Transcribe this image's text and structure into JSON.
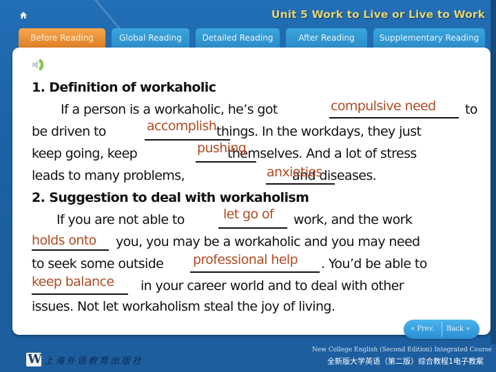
{
  "header": {
    "home_icon": "home-icon",
    "unit_title": "Unit 5  Work to Live or Live to Work"
  },
  "tabs": [
    {
      "label": "Before Reading",
      "active": true
    },
    {
      "label": "Global Reading",
      "active": false
    },
    {
      "label": "Detailed Reading",
      "active": false
    },
    {
      "label": "After Reading",
      "active": false
    },
    {
      "label": "Supplementary Reading",
      "active": false
    }
  ],
  "content": {
    "speaker_icon": "speaker-icon",
    "section1": {
      "heading": "1. Definition of workaholic",
      "l1_a": "If a person is a workaholic, he’s got",
      "l1_answer": "compulsive need",
      "l1_b": "to",
      "l2_a": "be driven to",
      "l2_answer": "accomplish",
      "l2_b": "things. In the workdays, they just",
      "l3_a": "keep going, keep",
      "l3_answer": "pushing",
      "l3_b": "themselves. And a lot of stress",
      "l4_a": "leads to many problems,",
      "l4_answer": "anxieties",
      "l4_b": "and diseases."
    },
    "section2": {
      "heading": "2. Suggestion to deal with workaholism",
      "l1_a": "If you are not able to",
      "l1_answer": "let go of",
      "l1_b": "work, and the work",
      "l2_answer": "holds onto",
      "l2_b": "you, you may be a workaholic and you may need",
      "l3_a": "to seek some outside",
      "l3_answer": "professional help",
      "l3_b": ". You’d be able to",
      "l4_answer": "keep balance",
      "l4_b": "in your career world and to deal with other",
      "l5": "issues. Not let workaholism steal the joy of living."
    }
  },
  "nav": {
    "prev_label": "«  Prev.",
    "back_label": "Back  »"
  },
  "footer": {
    "publisher_logo": "W",
    "publisher_name": "上海外语教育出版社",
    "course_en": "New College English (Second Edition) Integrated Course",
    "course_cn": "全新版大学英语（第二版）综合教程1电子教案"
  },
  "colors": {
    "background_blue": "#1c62a6",
    "active_tab": "#e98a2c",
    "inactive_tab": "#3399d3",
    "answer_text": "#b04a22",
    "title_gold": "#e3d67a"
  }
}
